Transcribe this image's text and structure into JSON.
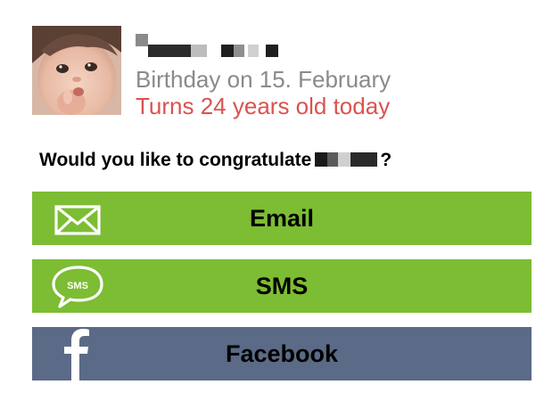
{
  "contact": {
    "birthday_text": "Birthday on 15. February",
    "turns_text": "Turns 24 years old today"
  },
  "prompt": {
    "text_before": "Would you like to congratulate",
    "text_after": "?"
  },
  "actions": [
    {
      "label": "Email",
      "icon": "envelope-icon",
      "color": "#7cbd33"
    },
    {
      "label": "SMS",
      "icon": "sms-bubble-icon",
      "color": "#7cbd33"
    },
    {
      "label": "Facebook",
      "icon": "facebook-icon",
      "color": "#5b6a86"
    }
  ],
  "colors": {
    "birthday_gray": "#8a8a8a",
    "turns_red": "#d9534f",
    "sms_email_green": "#7cbd33",
    "facebook_slate": "#5b6a86"
  }
}
